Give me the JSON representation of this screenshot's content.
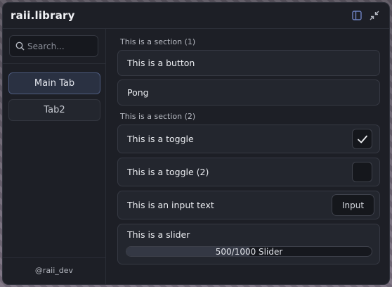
{
  "window": {
    "title": "raii.library"
  },
  "titlebar": {
    "icons": [
      "sidebar-toggle-icon",
      "collapse-icon"
    ],
    "accent": "#6f83c4"
  },
  "sidebar": {
    "search_placeholder": "Search...",
    "tabs": [
      {
        "label": "Main Tab",
        "active": true
      },
      {
        "label": "Tab2",
        "active": false
      }
    ],
    "footer": "@raii_dev"
  },
  "main": {
    "sections": [
      {
        "label": "This is a section (1)",
        "items": [
          {
            "type": "button",
            "label": "This is a button"
          },
          {
            "type": "button",
            "label": "Pong"
          }
        ]
      },
      {
        "label": "This is a section (2)",
        "items": [
          {
            "type": "toggle",
            "label": "This is a toggle",
            "checked": true
          },
          {
            "type": "toggle",
            "label": "This is a toggle (2)",
            "checked": false
          },
          {
            "type": "input",
            "label": "This is an input text",
            "value": "Input"
          },
          {
            "type": "slider",
            "label": "This is a slider",
            "value_text": "500/1000 Slider",
            "value": 500,
            "max": 1000
          }
        ]
      }
    ]
  }
}
